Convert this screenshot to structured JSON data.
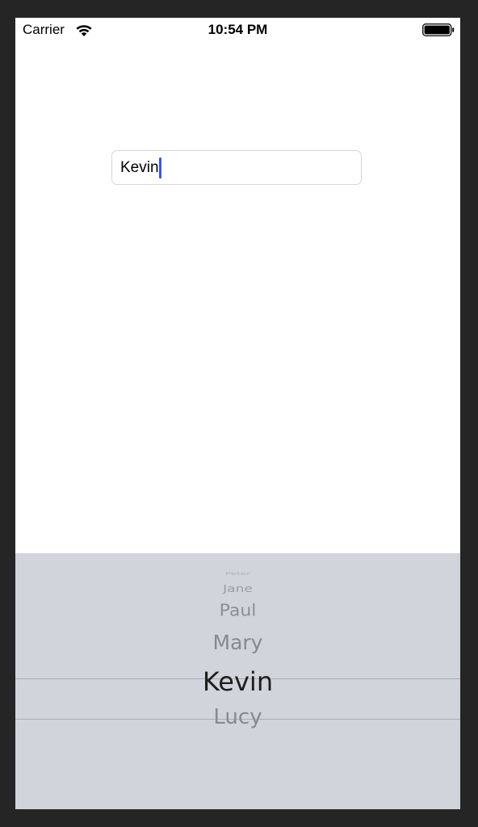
{
  "status_bar": {
    "carrier": "Carrier",
    "time": "10:54 PM",
    "icons": [
      "wifi-icon",
      "battery-icon"
    ]
  },
  "name_field": {
    "value": "Kevin",
    "cursor_color": "#3a5ae0"
  },
  "picker": {
    "background": "#d1d4db",
    "items": [
      {
        "label": "Peter"
      },
      {
        "label": "Jane"
      },
      {
        "label": "Paul"
      },
      {
        "label": "Mary"
      },
      {
        "label": "Kevin"
      },
      {
        "label": "Lucy"
      }
    ],
    "selected": "Kevin"
  }
}
